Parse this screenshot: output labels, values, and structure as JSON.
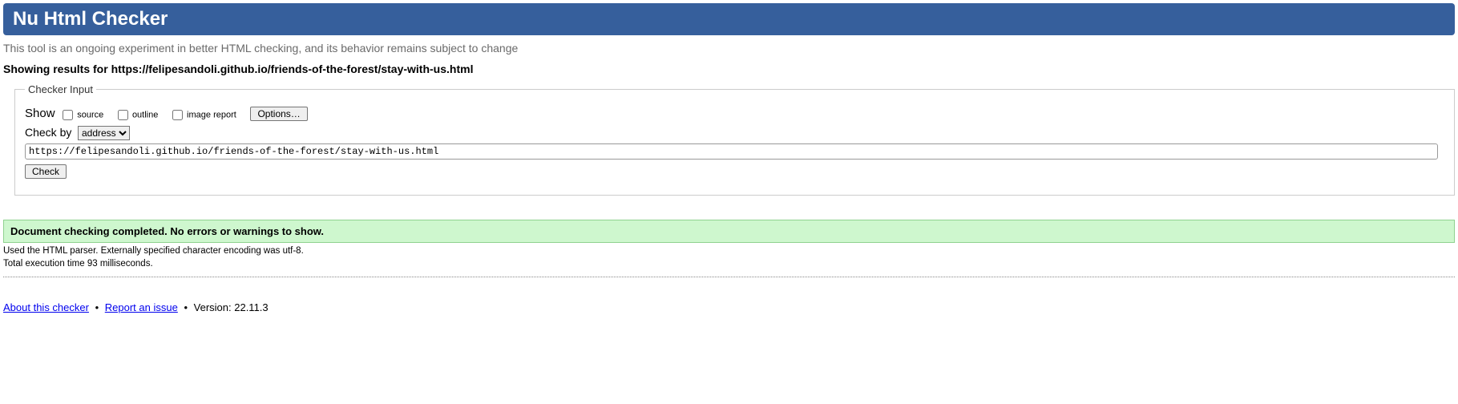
{
  "header": {
    "title": "Nu Html Checker"
  },
  "intro": "This tool is an ongoing experiment in better HTML checking, and its behavior remains subject to change",
  "results_for_prefix": "Showing results for ",
  "results_for_url": "https://felipesandoli.github.io/friends-of-the-forest/stay-with-us.html",
  "fieldset": {
    "legend": "Checker Input",
    "show_label": "Show",
    "source_label": "source",
    "outline_label": "outline",
    "image_report_label": "image report",
    "options_button": "Options…",
    "checkby_label": "Check by",
    "checkby_selected": "address",
    "url_value": "https://felipesandoli.github.io/friends-of-the-forest/stay-with-us.html",
    "check_button": "Check"
  },
  "success_message": "Document checking completed. No errors or warnings to show.",
  "parser_info": "Used the HTML parser. Externally specified character encoding was utf-8.",
  "exec_time": "Total execution time 93 milliseconds.",
  "footer": {
    "about_link": "About this checker",
    "report_link": "Report an issue",
    "version_label": "Version: ",
    "version_value": "22.11.3"
  }
}
